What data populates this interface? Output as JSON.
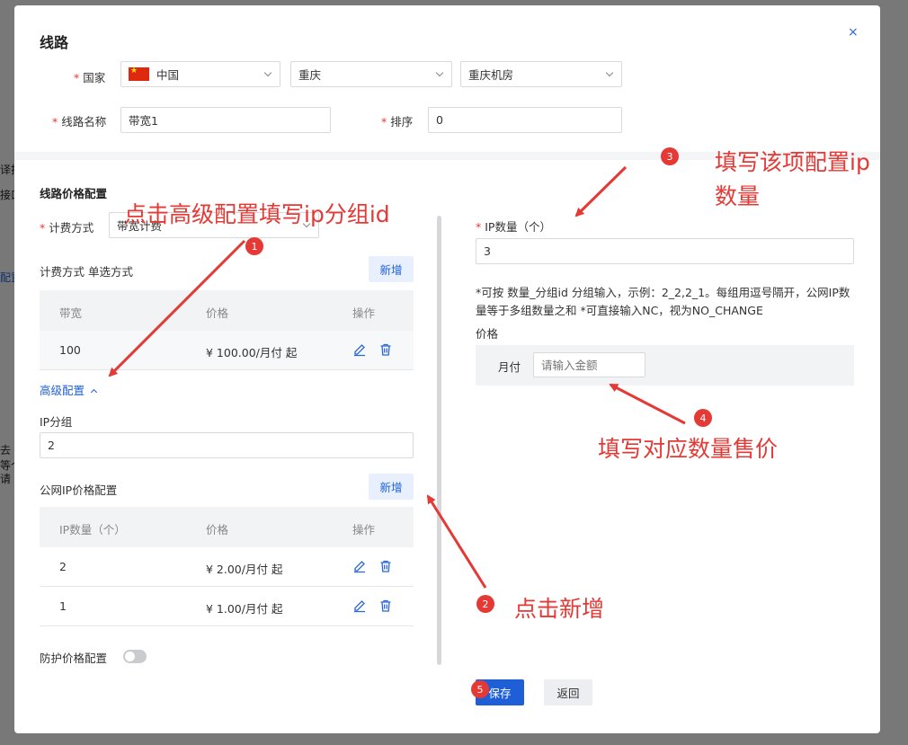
{
  "background_fragments": [
    "译抹",
    "接口",
    "配置",
    "去",
    "等个",
    "请"
  ],
  "dialog": {
    "title": "线路",
    "close_glyph": "×",
    "country_label": "国家",
    "country_value": "中国",
    "region_value": "重庆",
    "datacenter_value": "重庆机房",
    "line_name_label": "线路名称",
    "line_name_value": "带宽1",
    "sort_label": "排序",
    "sort_value": "0",
    "required_mark": "*"
  },
  "left": {
    "section_title": "线路价格配置",
    "billing_label": "计费方式",
    "billing_value": "带宽计费",
    "billing_method_title": "计费方式 单选方式",
    "add_label": "新增",
    "bandwidth_table": {
      "headers": [
        "带宽",
        "价格",
        "操作"
      ],
      "rows": [
        {
          "bandwidth": "100",
          "price": "¥ 100.00/月付  起"
        }
      ]
    },
    "advanced_link": "高级配置",
    "ip_group_label": "IP分组",
    "ip_group_value": "2",
    "public_ip_title": "公网IP价格配置",
    "ip_table": {
      "headers": [
        "IP数量（个）",
        "价格",
        "操作"
      ],
      "rows": [
        {
          "count": "2",
          "price": "¥ 2.00/月付  起"
        },
        {
          "count": "1",
          "price": "¥ 1.00/月付  起"
        }
      ]
    },
    "protection_label": "防护价格配置",
    "protection_enabled": false
  },
  "right": {
    "ip_count_label": "IP数量（个）",
    "ip_count_value": "3",
    "note": "*可按 数量_分组id 分组输入，示例：2_2,2_1。每组用逗号隔开，公网IP数量等于多组数量之和 *可直接输入NC，视为NO_CHANGE",
    "price_label": "价格",
    "monthly_label": "月付",
    "amount_placeholder": "请输入金额"
  },
  "footer": {
    "save": "保存",
    "back": "返回"
  },
  "annotations": {
    "color": "#e53935",
    "items": [
      {
        "badge": "1",
        "text": "点击高级配置填写ip分组id"
      },
      {
        "badge": "2",
        "text": "点击新增"
      },
      {
        "badge": "3",
        "text_line1": "填写该项配置ip",
        "text_line2": "数量"
      },
      {
        "badge": "4",
        "text": "填写对应数量售价"
      },
      {
        "badge": "5"
      }
    ]
  }
}
